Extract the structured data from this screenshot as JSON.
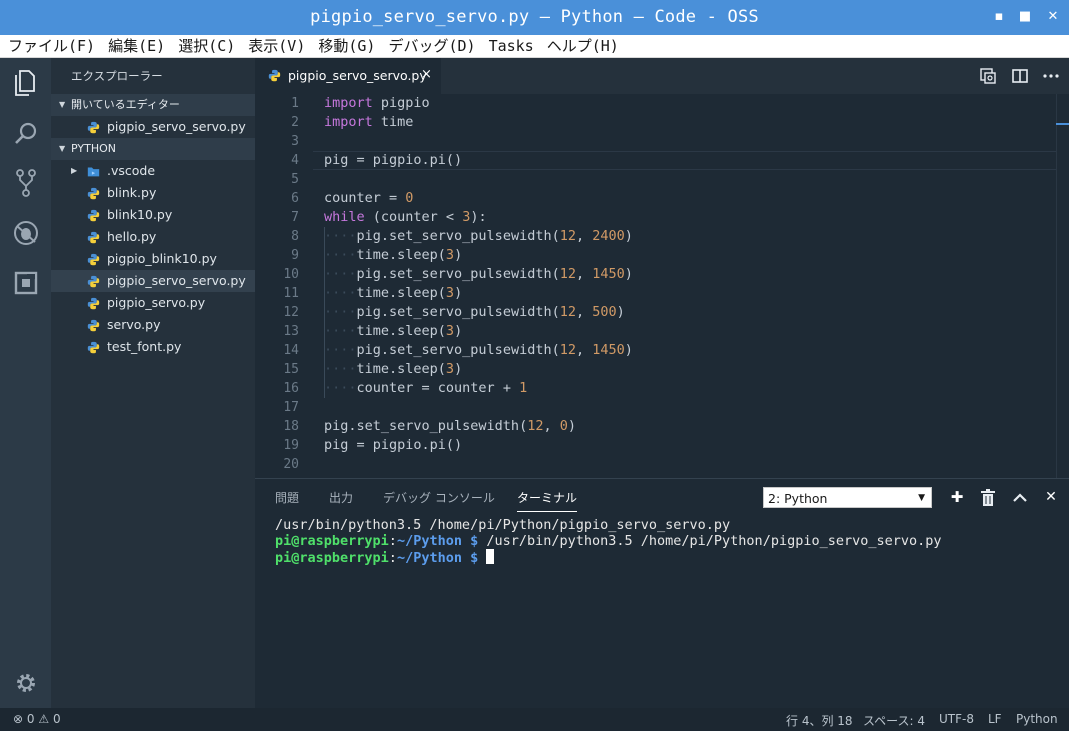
{
  "window": {
    "title": "pigpio_servo_servo.py — Python — Code - OSS"
  },
  "menu": [
    "ファイル(F)",
    "編集(E)",
    "選択(C)",
    "表示(V)",
    "移動(G)",
    "デバッグ(D)",
    "Tasks",
    "ヘルプ(H)"
  ],
  "activity_bar": [
    "explorer-icon",
    "search-icon",
    "source-control-icon",
    "debug-icon",
    "extensions-icon",
    "gear-icon"
  ],
  "sidebar": {
    "header": "エクスプローラー",
    "open_editors_label": "開いているエディター",
    "open_editors": [
      "pigpio_servo_servo.py"
    ],
    "folder_label": "PYTHON",
    "folder_items": [
      ".vscode",
      "blink.py",
      "blink10.py",
      "hello.py",
      "pigpio_blink10.py",
      "pigpio_servo_servo.py",
      "pigpio_servo.py",
      "servo.py",
      "test_font.py"
    ],
    "selected_item": "pigpio_servo_servo.py"
  },
  "editor": {
    "tab_label": "pigpio_servo_servo.py",
    "tab_close": "×",
    "lines": [
      "import pigpio",
      "import time",
      "",
      "pig = pigpio.pi()",
      "",
      "counter = 0",
      "while (counter < 3):",
      "····pig.set_servo_pulsewidth(12, 2400)",
      "····time.sleep(3)",
      "····pig.set_servo_pulsewidth(12, 1450)",
      "····time.sleep(3)",
      "····pig.set_servo_pulsewidth(12, 500)",
      "····time.sleep(3)",
      "····pig.set_servo_pulsewidth(12, 1450)",
      "····time.sleep(3)",
      "····counter = counter + 1",
      "",
      "pig.set_servo_pulsewidth(12, 0)",
      "pig = pigpio.pi()",
      ""
    ],
    "current_line": 4
  },
  "panel": {
    "tabs": [
      "問題",
      "出力",
      "デバッグ コンソール",
      "ターミナル"
    ],
    "active_tab": "ターミナル",
    "terminal_select": "2: Python",
    "terminal": {
      "line1": "/usr/bin/python3.5 /home/pi/Python/pigpio_servo_servo.py",
      "prompt_user": "pi@raspberrypi",
      "prompt_sep": ":",
      "prompt_path": "~/Python $",
      "line2_cmd": " /usr/bin/python3.5 /home/pi/Python/pigpio_servo_servo.py"
    }
  },
  "status": {
    "errors": "0",
    "warnings": "0",
    "position": "行 4、列 18",
    "spaces": "スペース: 4",
    "encoding": "UTF-8",
    "eol": "LF",
    "language": "Python"
  },
  "colors": {
    "titlebar": "#4a90d9",
    "keyword": "#c678dd",
    "number": "#d19a66",
    "prompt_user": "#4fe06a",
    "prompt_path": "#5c9ded"
  }
}
